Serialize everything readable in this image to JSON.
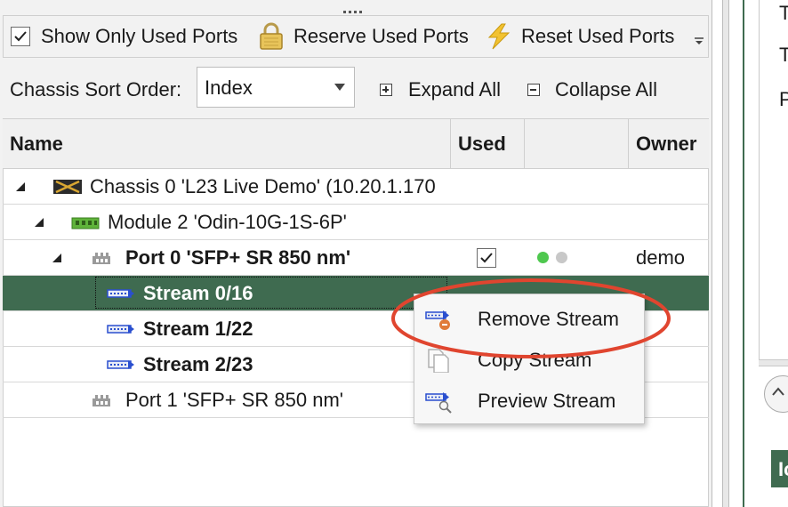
{
  "toolbar": {
    "show_only_used_ports": "Show Only Used Ports",
    "show_only_used_ports_checked": true,
    "reserve_used_ports": "Reserve Used Ports",
    "reset_used_ports": "Reset Used Ports"
  },
  "sort": {
    "label": "Chassis Sort Order:",
    "value": "Index",
    "expand_all": "Expand All",
    "collapse_all": "Collapse All"
  },
  "grid": {
    "columns": [
      "Name",
      "Used",
      "",
      "Owner"
    ],
    "rows": [
      {
        "name": "Chassis 0 'L23 Live Demo' (10.20.1.170",
        "type": "chassis",
        "bold": false
      },
      {
        "name": "Module 2 'Odin-10G-1S-6P'",
        "type": "module",
        "bold": false
      },
      {
        "name": "Port 0 'SFP+ SR 850 nm'",
        "type": "port",
        "bold": true,
        "used": true,
        "owner": "demo",
        "status_colors": [
          "#4fc84f",
          "#c8c8c8"
        ]
      },
      {
        "name": "Stream 0/16",
        "type": "stream",
        "bold": true,
        "selected": true
      },
      {
        "name": "Stream 1/22",
        "type": "stream",
        "bold": true
      },
      {
        "name": "Stream 2/23",
        "type": "stream",
        "bold": true
      },
      {
        "name": "Port 1 'SFP+ SR 850 nm'",
        "type": "port",
        "bold": false
      }
    ]
  },
  "context_menu": {
    "items": [
      {
        "label": "Remove Stream",
        "icon": "remove-stream-icon"
      },
      {
        "label": "Copy Stream",
        "icon": "copy-stream-icon"
      },
      {
        "label": "Preview Stream",
        "icon": "preview-stream-icon"
      }
    ]
  },
  "right_panel": {
    "lines": [
      "T",
      "T",
      "P"
    ],
    "section_label": "Ic"
  },
  "colors": {
    "selection": "#3f6b50",
    "annotation": "#e0452f",
    "accent": "#3f6b50"
  }
}
